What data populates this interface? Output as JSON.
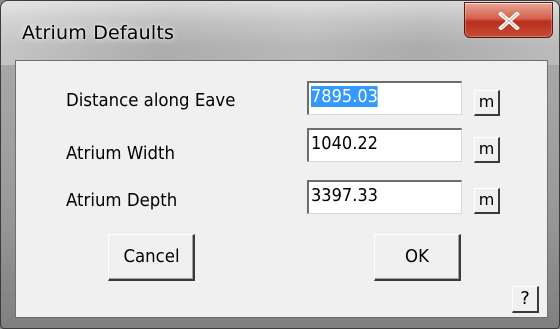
{
  "window": {
    "title": "Atrium Defaults",
    "close_icon": "close-x-icon"
  },
  "fields": [
    {
      "label": "Distance along Eave",
      "value": "7895.03",
      "selected": true,
      "unit": "m"
    },
    {
      "label": "Atrium Width",
      "value": "1040.22",
      "selected": false,
      "unit": "m"
    },
    {
      "label": "Atrium Depth",
      "value": "3397.33",
      "selected": false,
      "unit": "m"
    }
  ],
  "buttons": {
    "cancel_label": "Cancel",
    "ok_label": "OK",
    "help_label": "?"
  },
  "colors": {
    "selection": "#3399ff",
    "close_button": "#c64a33",
    "dialog_face": "#f0f0f0"
  }
}
